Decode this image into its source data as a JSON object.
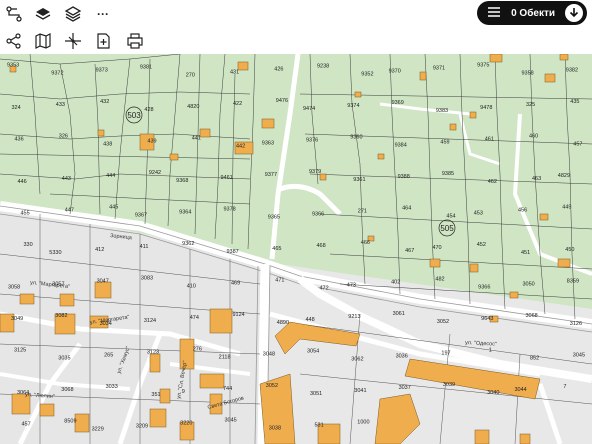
{
  "toolbar": {
    "row1": [
      {
        "name": "route-icon"
      },
      {
        "name": "layers-icon"
      },
      {
        "name": "layers-stack-icon"
      },
      {
        "name": "more-icon",
        "glyph": "···"
      }
    ],
    "row2": [
      {
        "name": "share-icon"
      },
      {
        "name": "map-icon"
      },
      {
        "name": "measure-icon"
      },
      {
        "name": "add-note-icon"
      },
      {
        "name": "print-icon"
      }
    ],
    "objects_label": "0 Обекти"
  },
  "map": {
    "circled_labels": [
      "503",
      "505"
    ],
    "street_labels": [
      {
        "text": "Зорница",
        "name": "street-label-zornitsa"
      },
      {
        "text": "ул. \"Маргарета\"",
        "name": "street-label-margareta-1"
      },
      {
        "text": "ул. \"Маргарета\"",
        "name": "street-label-margareta-2"
      },
      {
        "text": "ул. \"Одесос\"",
        "name": "street-label-odesos"
      },
      {
        "text": "ул. \"Люлин\"",
        "name": "street-label-lyulin"
      },
      {
        "text": "ул. \"Хемус\"",
        "name": "street-label-hemus"
      },
      {
        "text": "ул. \"Сл. Вечер\"",
        "name": "street-label-vecher"
      },
      {
        "text": "Света Богоров",
        "name": "street-label-bogorov"
      }
    ],
    "parcel_labels": [
      "9353",
      "9372",
      "9373",
      "9381",
      "270",
      "431",
      "426",
      "9238",
      "9352",
      "9370",
      "9371",
      "9375",
      "9358",
      "9382",
      "324",
      "433",
      "432",
      "428",
      "4820",
      "422",
      "9476",
      "9474",
      "9374",
      "9369",
      "9383",
      "9478",
      "325",
      "435",
      "436",
      "326",
      "438",
      "439",
      "441",
      "442",
      "9363",
      "9376",
      "9360",
      "9384",
      "459",
      "461",
      "460",
      "457",
      "446",
      "443",
      "444",
      "9242",
      "9368",
      "9461",
      "9377",
      "9379",
      "9361",
      "9388",
      "9385",
      "462",
      "463",
      "4829",
      "455",
      "447",
      "445",
      "9367",
      "9364",
      "9378",
      "9365",
      "9366",
      "271",
      "464",
      "454",
      "453",
      "456",
      "449",
      "330",
      "5330",
      "412",
      "411",
      "9362",
      "9387",
      "465",
      "468",
      "466",
      "467",
      "470",
      "452",
      "451",
      "450",
      "3058",
      "3057",
      "3047",
      "3083",
      "410",
      "469",
      "471",
      "472",
      "473",
      "402",
      "482",
      "9366",
      "3050",
      "8359",
      "3049",
      "3082",
      "3034",
      "3124",
      "474",
      "9124",
      "4890",
      "448",
      "9213",
      "3061",
      "3052",
      "9643",
      "3068",
      "3126",
      "3125",
      "3035",
      "265",
      "3123",
      "276",
      "2118",
      "3048",
      "3054",
      "3062",
      "3036",
      "197",
      "1",
      "852",
      "3045",
      "3064",
      "3068",
      "3033",
      "351",
      "9",
      "744",
      "3052",
      "3051",
      "3041",
      "3037",
      "3039",
      "3040",
      "3044",
      "7",
      "457",
      "8509",
      "3229",
      "3209",
      "3220",
      "3045",
      "3038",
      "531",
      "1000"
    ],
    "small_labels": [
      "9376",
      "505",
      "407",
      "3",
      "10",
      "50"
    ]
  }
}
